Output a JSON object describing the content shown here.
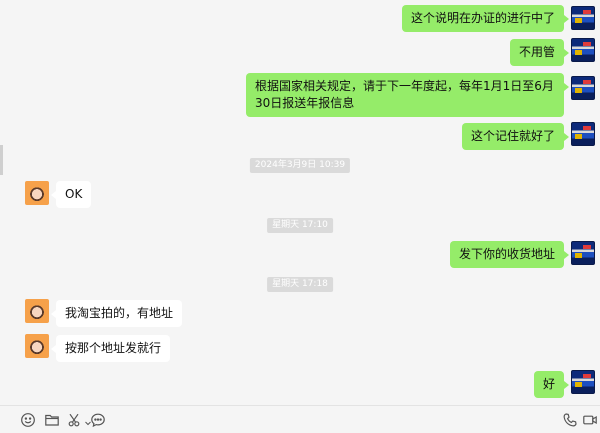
{
  "messages": [
    {
      "side": "me",
      "text": "这个说明在办证的进行中了"
    },
    {
      "side": "me",
      "text": "不用管"
    },
    {
      "side": "me",
      "text": "根据国家相关规定，请于下一年度起，每年1月1日至6月30日报送年报信息"
    },
    {
      "side": "me",
      "text": "这个记住就好了"
    },
    {
      "timestamp": "2024年3月9日 10:39"
    },
    {
      "side": "them",
      "text": "OK"
    },
    {
      "timestamp": "星期天 17:10"
    },
    {
      "side": "me",
      "text": "发下你的收货地址"
    },
    {
      "timestamp": "星期天 17:18"
    },
    {
      "side": "them",
      "text": "我淘宝拍的，有地址"
    },
    {
      "side": "them",
      "text": "按那个地址发就行"
    },
    {
      "side": "me",
      "text": "好"
    }
  ],
  "toolbar": {
    "left_icons": [
      "emoji-icon",
      "folder-icon",
      "scissors-icon",
      "chat-history-icon"
    ],
    "right_icons": [
      "voice-call-icon",
      "video-call-icon"
    ]
  },
  "colors": {
    "background": "#f5f5f5",
    "my_bubble": "#95ec69",
    "their_bubble": "#ffffff",
    "timestamp_bg": "#dadada"
  }
}
